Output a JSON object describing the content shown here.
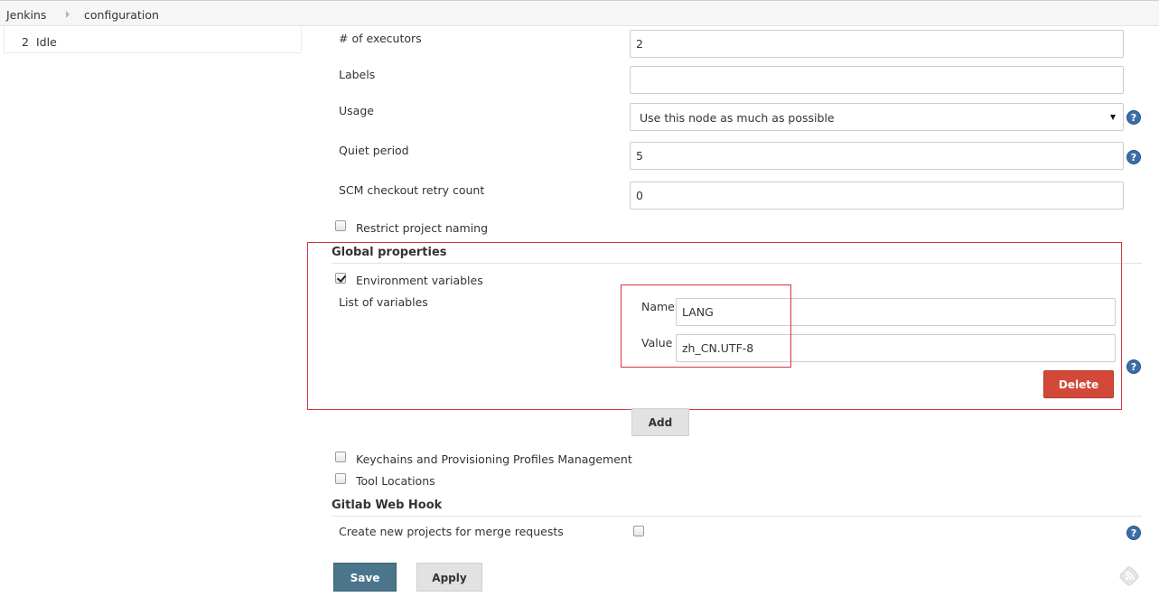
{
  "breadcrumb": {
    "items": [
      "Jenkins",
      "configuration"
    ]
  },
  "executors": {
    "number": "2",
    "status": "Idle"
  },
  "form": {
    "executors_label": "# of executors",
    "executors_value": "2",
    "labels_label": "Labels",
    "labels_value": "",
    "usage_label": "Usage",
    "usage_value": "Use this node as much as possible",
    "quiet_label": "Quiet period",
    "quiet_value": "5",
    "scm_label": "SCM checkout retry count",
    "scm_value": "0",
    "restrict_label": "Restrict project naming",
    "restrict_checked": false
  },
  "global_properties": {
    "title": "Global properties",
    "env_label": "Environment variables",
    "env_checked": true,
    "list_label": "List of variables",
    "name_label": "Name",
    "name_value": "LANG",
    "value_label": "Value",
    "value_value": "zh_CN.UTF-8",
    "delete_label": "Delete",
    "add_label": "Add"
  },
  "extras": {
    "keychains_label": "Keychains and Provisioning Profiles Management",
    "tool_locations_label": "Tool Locations"
  },
  "gitlab": {
    "title": "Gitlab Web Hook",
    "merge_label": "Create new projects for merge requests"
  },
  "footer": {
    "save_label": "Save",
    "apply_label": "Apply"
  },
  "colors": {
    "save_button": "#4b758b",
    "delete_button": "#d24939",
    "help_icon": "#3b6ea8",
    "highlight_box": "#d83340"
  },
  "icons": [
    "help-icon",
    "chevron-right-icon",
    "dropdown-arrow-icon",
    "feed-icon"
  ]
}
